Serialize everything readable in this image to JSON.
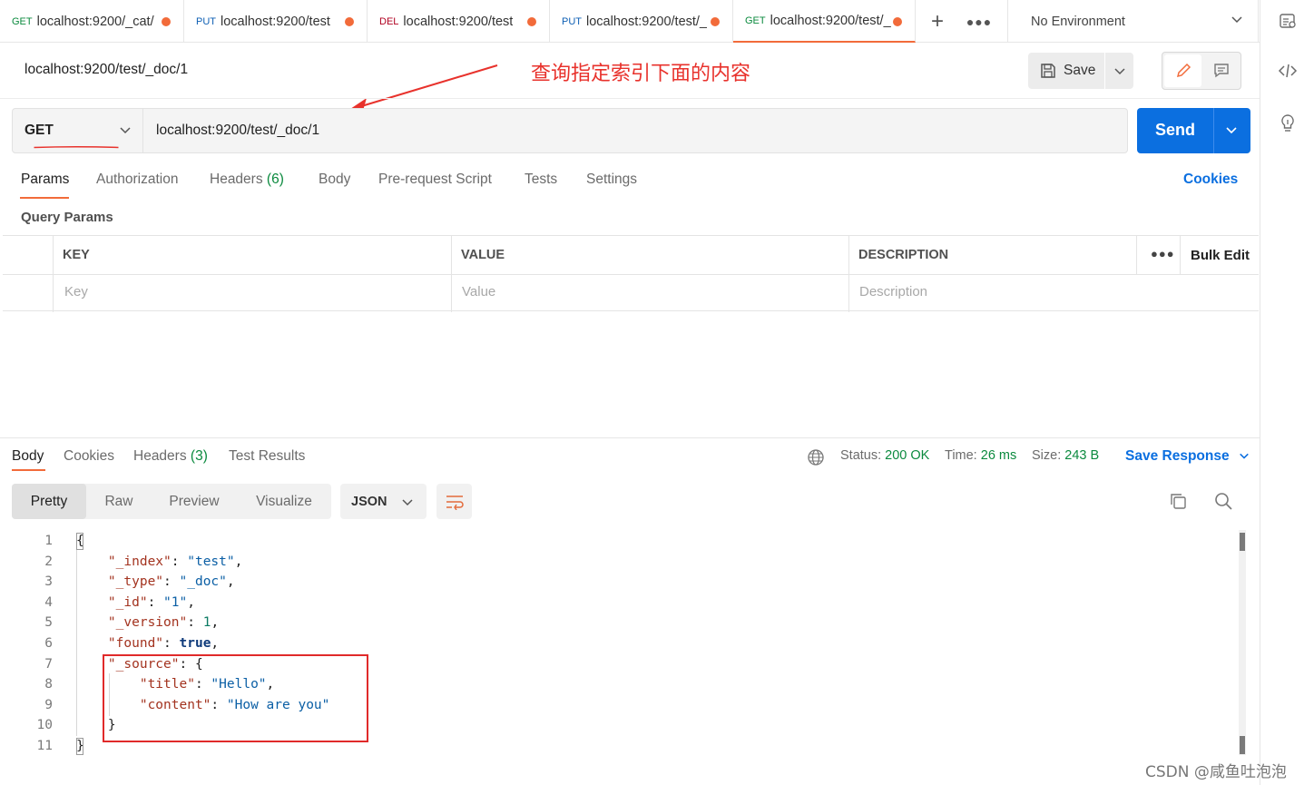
{
  "tabs": [
    {
      "method": "GET",
      "url": "localhost:9200/_cat/"
    },
    {
      "method": "PUT",
      "url": "localhost:9200/test"
    },
    {
      "method": "DEL",
      "url": "localhost:9200/test"
    },
    {
      "method": "PUT",
      "url": "localhost:9200/test/_"
    },
    {
      "method": "GET",
      "url": "localhost:9200/test/_"
    }
  ],
  "environment": "No Environment",
  "request": {
    "title": "localhost:9200/test/_doc/1",
    "method": "GET",
    "url": "localhost:9200/test/_doc/1",
    "save_label": "Save",
    "send_label": "Send"
  },
  "annotation": "查询指定索引下面的内容",
  "request_tabs": [
    {
      "label": "Params",
      "count": ""
    },
    {
      "label": "Authorization",
      "count": ""
    },
    {
      "label": "Headers",
      "count": "(6)"
    },
    {
      "label": "Body",
      "count": ""
    },
    {
      "label": "Pre-request Script",
      "count": ""
    },
    {
      "label": "Tests",
      "count": ""
    },
    {
      "label": "Settings",
      "count": ""
    }
  ],
  "cookies_link": "Cookies",
  "query_params": {
    "title": "Query Params",
    "headers": [
      "KEY",
      "VALUE",
      "DESCRIPTION"
    ],
    "placeholders": [
      "Key",
      "Value",
      "Description"
    ],
    "bulk_edit": "Bulk Edit"
  },
  "response_tabs": [
    {
      "label": "Body",
      "count": ""
    },
    {
      "label": "Cookies",
      "count": ""
    },
    {
      "label": "Headers",
      "count": "(3)"
    },
    {
      "label": "Test Results",
      "count": ""
    }
  ],
  "response_status": {
    "status_label": "Status:",
    "status_value": "200 OK",
    "time_label": "Time:",
    "time_value": "26 ms",
    "size_label": "Size:",
    "size_value": "243 B"
  },
  "save_response": "Save Response",
  "view_modes": [
    "Pretty",
    "Raw",
    "Preview",
    "Visualize"
  ],
  "format": "JSON",
  "code_lines": [
    {
      "n": "1",
      "tokens": [
        [
          "p",
          "{"
        ]
      ]
    },
    {
      "n": "2",
      "tokens": [
        [
          "p",
          "    "
        ],
        [
          "k",
          "\"_index\""
        ],
        [
          "p",
          ": "
        ],
        [
          "s",
          "\"test\""
        ],
        [
          "p",
          ","
        ]
      ]
    },
    {
      "n": "3",
      "tokens": [
        [
          "p",
          "    "
        ],
        [
          "k",
          "\"_type\""
        ],
        [
          "p",
          ": "
        ],
        [
          "s",
          "\"_doc\""
        ],
        [
          "p",
          ","
        ]
      ]
    },
    {
      "n": "4",
      "tokens": [
        [
          "p",
          "    "
        ],
        [
          "k",
          "\"_id\""
        ],
        [
          "p",
          ": "
        ],
        [
          "s",
          "\"1\""
        ],
        [
          "p",
          ","
        ]
      ]
    },
    {
      "n": "5",
      "tokens": [
        [
          "p",
          "    "
        ],
        [
          "k",
          "\"_version\""
        ],
        [
          "p",
          ": "
        ],
        [
          "n",
          "1"
        ],
        [
          "p",
          ","
        ]
      ]
    },
    {
      "n": "6",
      "tokens": [
        [
          "p",
          "    "
        ],
        [
          "k",
          "\"found\""
        ],
        [
          "p",
          ": "
        ],
        [
          "b",
          "true"
        ],
        [
          "p",
          ","
        ]
      ]
    },
    {
      "n": "7",
      "tokens": [
        [
          "p",
          "    "
        ],
        [
          "k",
          "\"_source\""
        ],
        [
          "p",
          ": {"
        ]
      ]
    },
    {
      "n": "8",
      "tokens": [
        [
          "p",
          "        "
        ],
        [
          "k",
          "\"title\""
        ],
        [
          "p",
          ": "
        ],
        [
          "s",
          "\"Hello\""
        ],
        [
          "p",
          ","
        ]
      ]
    },
    {
      "n": "9",
      "tokens": [
        [
          "p",
          "        "
        ],
        [
          "k",
          "\"content\""
        ],
        [
          "p",
          ": "
        ],
        [
          "s",
          "\"How are you\""
        ]
      ]
    },
    {
      "n": "10",
      "tokens": [
        [
          "p",
          "    }"
        ]
      ]
    },
    {
      "n": "11",
      "tokens": [
        [
          "p",
          "}"
        ]
      ]
    }
  ],
  "watermark": "CSDN @咸鱼吐泡泡",
  "colors": {
    "accent": "#f26b3a",
    "send": "#0b6fe0",
    "annotation": "#e8322c"
  }
}
